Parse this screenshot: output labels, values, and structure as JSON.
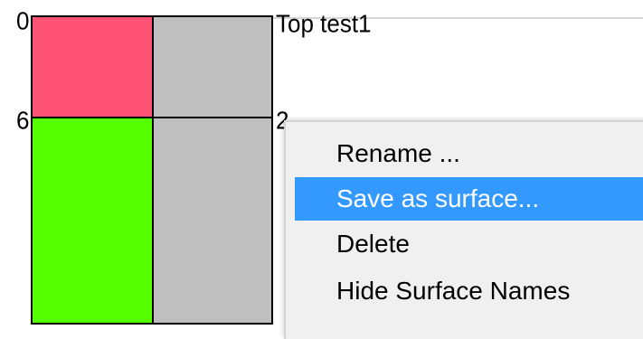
{
  "axis": {
    "top_label": "0",
    "mid_label": "6"
  },
  "surfaces": {
    "top_name": "Top test1",
    "second_name": "2"
  },
  "colors": {
    "layer1": "#ff5376",
    "layer2": "#55ff00",
    "track_gray": "#bfbfbf",
    "menu_bg": "#f0f0f0",
    "menu_highlight": "#3399ff"
  },
  "context_menu": {
    "items": [
      {
        "label": "Rename ..."
      },
      {
        "label": "Save as surface..."
      },
      {
        "label": "Delete"
      },
      {
        "label": "Hide Surface Names"
      }
    ],
    "selected_item": "Save as surface..."
  }
}
